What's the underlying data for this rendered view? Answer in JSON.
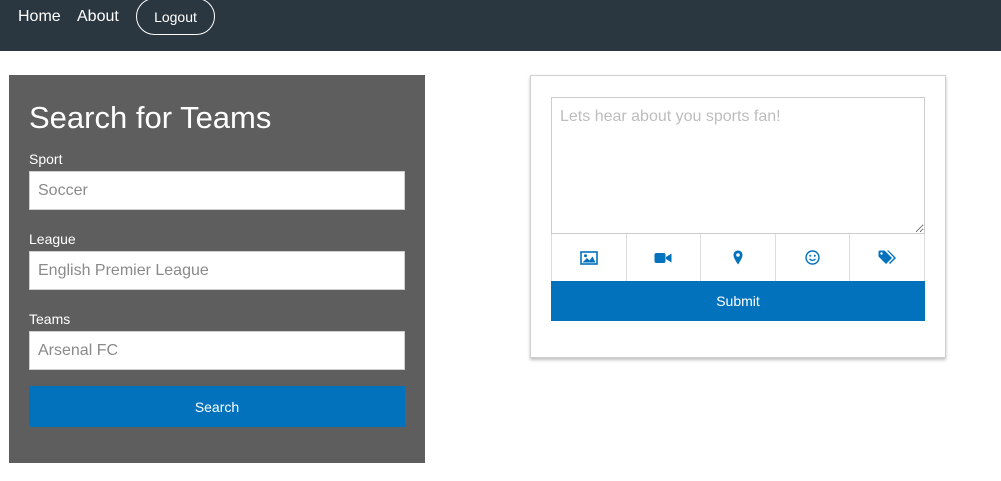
{
  "nav": {
    "home_label": "Home",
    "about_label": "About",
    "logout_label": "Logout"
  },
  "search": {
    "title": "Search for Teams",
    "sport_label": "Sport",
    "sport_placeholder": "Soccer",
    "league_label": "League",
    "league_placeholder": "English Premier League",
    "teams_label": "Teams",
    "teams_placeholder": "Arsenal FC",
    "button_label": "Search"
  },
  "post": {
    "placeholder": "Lets hear about you sports fan!",
    "icons": [
      "image-icon",
      "video-camera-icon",
      "map-pin-icon",
      "smiley-icon",
      "tags-icon"
    ],
    "submit_label": "Submit"
  },
  "colors": {
    "navbar": "#2a3640",
    "panel": "#5e5e5e",
    "accent": "#0272bd"
  }
}
